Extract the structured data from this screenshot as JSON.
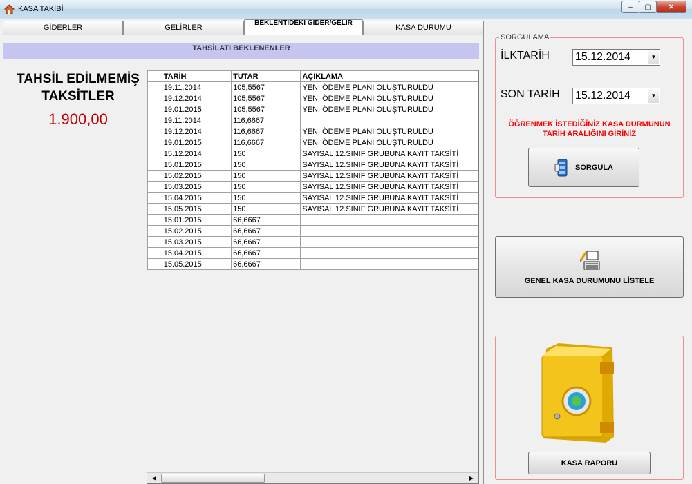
{
  "window": {
    "title": "KASA TAKİBİ",
    "min_label": "‒",
    "max_label": "▢",
    "close_label": "✕"
  },
  "tabs": [
    {
      "label": "GİDERLER"
    },
    {
      "label": "GELİRLER"
    },
    {
      "label": "BEKLENTİDEKİ GİDER/GELİR"
    },
    {
      "label": "KASA DURUMU"
    }
  ],
  "section_header": "TAHSİLATI BEKLENENLER",
  "summary": {
    "title_line1": "TAHSİL EDİLMEMİŞ",
    "title_line2": "TAKSİTLER",
    "amount": "1.900,00"
  },
  "grid": {
    "columns": [
      "TARİH",
      "TUTAR",
      "AÇIKLAMA"
    ],
    "rows": [
      [
        "19.11.2014",
        "105,5567",
        "YENİ ÖDEME PLANI OLUŞTURULDU"
      ],
      [
        "19.12.2014",
        "105,5567",
        "YENİ ÖDEME PLANI OLUŞTURULDU"
      ],
      [
        "19.01.2015",
        "105,5567",
        "YENİ ÖDEME PLANI OLUŞTURULDU"
      ],
      [
        "19.11.2014",
        "116,6667",
        ""
      ],
      [
        "19.12.2014",
        "116,6667",
        "YENİ ÖDEME PLANI OLUŞTURULDU"
      ],
      [
        "19.01.2015",
        "116,6667",
        "YENİ ÖDEME PLANI OLUŞTURULDU"
      ],
      [
        "15.12.2014",
        "150",
        "SAYISAL 12.SINIF GRUBUNA KAYIT TAKSİTİ"
      ],
      [
        "15.01.2015",
        "150",
        "SAYISAL 12.SINIF GRUBUNA KAYIT TAKSİTİ"
      ],
      [
        "15.02.2015",
        "150",
        "SAYISAL 12.SINIF GRUBUNA KAYIT TAKSİTİ"
      ],
      [
        "15.03.2015",
        "150",
        "SAYISAL 12.SINIF GRUBUNA KAYIT TAKSİTİ"
      ],
      [
        "15.04.2015",
        "150",
        "SAYISAL 12.SINIF GRUBUNA KAYIT TAKSİTİ"
      ],
      [
        "15.05.2015",
        "150",
        "SAYISAL 12.SINIF GRUBUNA KAYIT TAKSİTİ"
      ],
      [
        "15.01.2015",
        "66,6667",
        ""
      ],
      [
        "15.02.2015",
        "66,6667",
        ""
      ],
      [
        "15.03.2015",
        "66,6667",
        ""
      ],
      [
        "15.04.2015",
        "66,6667",
        ""
      ],
      [
        "15.05.2015",
        "66,6667",
        ""
      ]
    ]
  },
  "query": {
    "legend": "SORGULAMA",
    "start_label": "İLKTARİH",
    "start_value": "15.12.2014",
    "end_label": "SON TARİH",
    "end_value": "15.12.2014",
    "hint": "ÖĞRENMEK İSTEDİĞİNİZ KASA DURMUNUN TARİH ARALIĞINI GİRİNİZ",
    "button_label": "SORGULA"
  },
  "general_button_label": "GENEL KASA DURUMUNU LİSTELE",
  "report_button_label": "KASA RAPORU",
  "icons": {
    "app": "house-icon",
    "query": "database-icon",
    "general": "computer-edit-icon",
    "safe": "safe-icon"
  },
  "colors": {
    "amount": "#c00000",
    "hint": "#ff0000",
    "header_band": "#c5c5f0",
    "panel_border": "#e89090"
  }
}
